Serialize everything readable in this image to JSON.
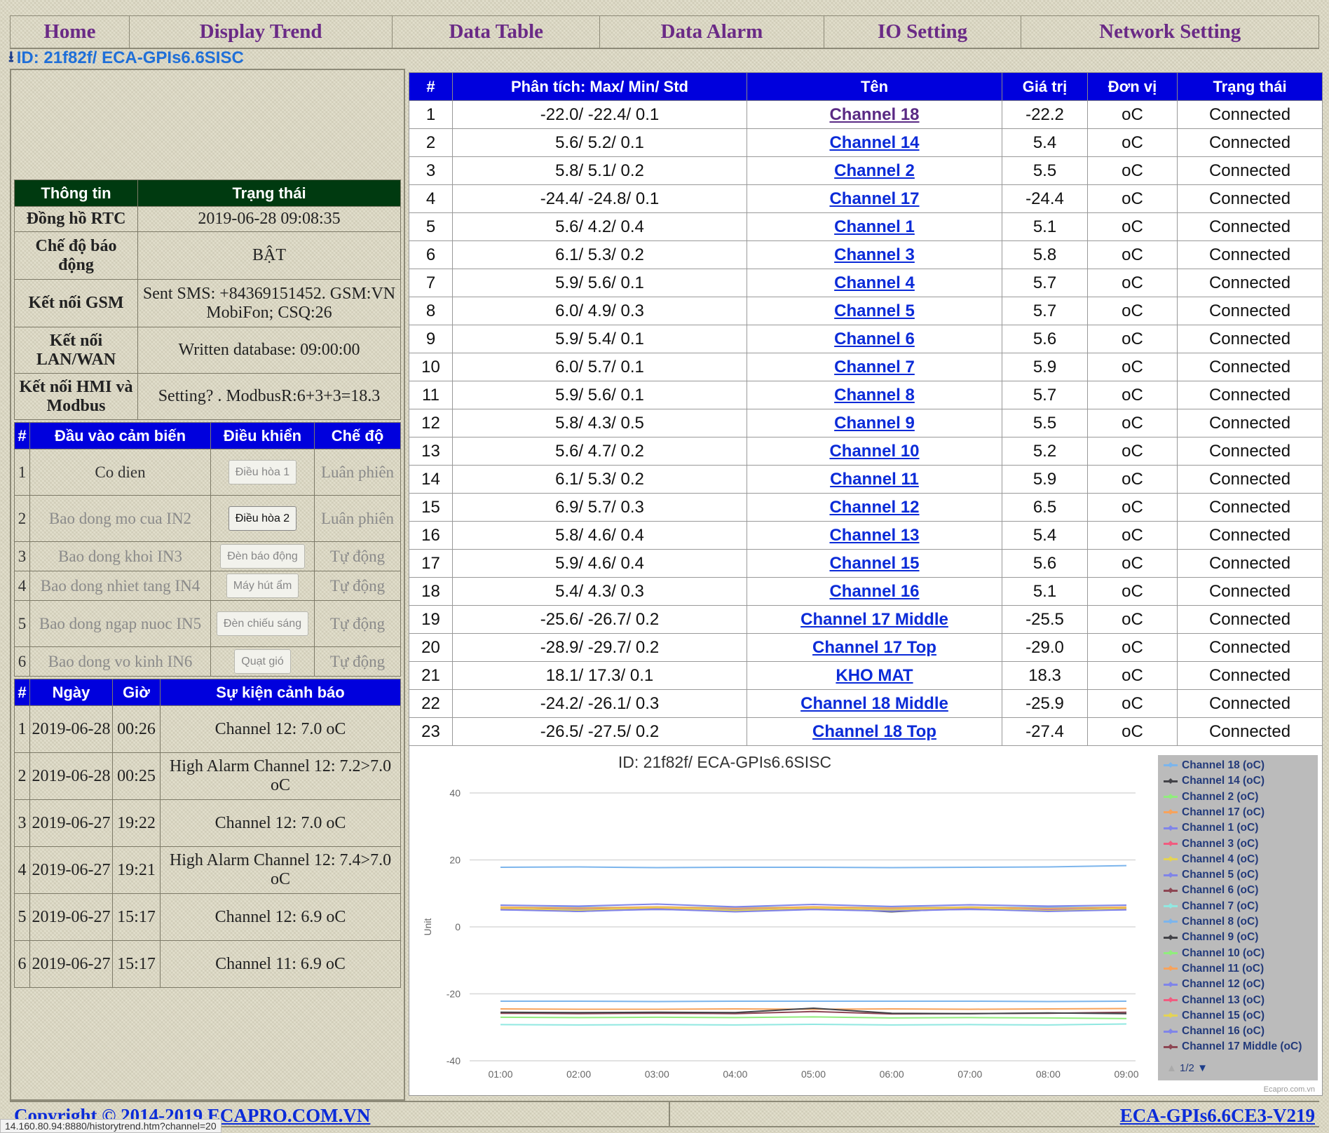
{
  "nav": [
    "Home",
    "Display Trend",
    "Data Table",
    "Data Alarm",
    "IO Setting",
    "Network Setting"
  ],
  "device_id": "ID: 21f82f/ ECA-GPIs6.6SISC",
  "info": {
    "headers": [
      "Thông tin",
      "Trạng thái"
    ],
    "rows": [
      {
        "label": "Đồng hồ RTC",
        "value": "2019-06-28 09:08:35"
      },
      {
        "label": "Chế độ báo động",
        "value": "BẬT"
      },
      {
        "label": "Kết nối GSM",
        "value": "Sent SMS: +84369151452. GSM:VN MobiFon; CSQ:26"
      },
      {
        "label": "Kết nối LAN/WAN",
        "value": "Written database: 09:00:00"
      },
      {
        "label": "Kết nối HMI và Modbus",
        "value": "Setting? . ModbusR:6+3+3=18.3"
      }
    ]
  },
  "sensors": {
    "headers": [
      "#",
      "Đầu vào cảm biến",
      "Điều khiển",
      "Chế độ"
    ],
    "rows": [
      {
        "n": "1",
        "input": "Co dien",
        "control": "Điều hòa 1",
        "mode": "Luân phiên"
      },
      {
        "n": "2",
        "input": "Bao dong mo cua IN2",
        "control": "Điều hòa 2",
        "mode": "Luân phiên"
      },
      {
        "n": "3",
        "input": "Bao dong khoi IN3",
        "control": "Đèn báo động",
        "mode": "Tự động"
      },
      {
        "n": "4",
        "input": "Bao dong nhiet tang IN4",
        "control": "Máy hút ẩm",
        "mode": "Tự động"
      },
      {
        "n": "5",
        "input": "Bao dong ngap nuoc IN5",
        "control": "Đèn chiếu sáng",
        "mode": "Tự động"
      },
      {
        "n": "6",
        "input": "Bao dong vo kinh IN6",
        "control": "Quạt gió",
        "mode": "Tự động"
      }
    ]
  },
  "alarms": {
    "headers": [
      "#",
      "Ngày",
      "Giờ",
      "Sự kiện cảnh báo"
    ],
    "rows": [
      {
        "n": "1",
        "date": "2019-06-28",
        "time": "00:26",
        "event": "Channel 12: 7.0 oC"
      },
      {
        "n": "2",
        "date": "2019-06-28",
        "time": "00:25",
        "event": "High Alarm Channel 12: 7.2>7.0 oC"
      },
      {
        "n": "3",
        "date": "2019-06-27",
        "time": "19:22",
        "event": "Channel 12: 7.0 oC"
      },
      {
        "n": "4",
        "date": "2019-06-27",
        "time": "19:21",
        "event": "High Alarm Channel 12: 7.4>7.0 oC"
      },
      {
        "n": "5",
        "date": "2019-06-27",
        "time": "15:17",
        "event": "Channel 12: 6.9 oC"
      },
      {
        "n": "6",
        "date": "2019-06-27",
        "time": "15:17",
        "event": "Channel 11: 6.9 oC"
      }
    ]
  },
  "data_table": {
    "headers": [
      "#",
      "Phân tích: Max/ Min/ Std",
      "Tên",
      "Giá trị",
      "Đơn vị",
      "Trạng thái"
    ],
    "rows": [
      {
        "n": "1",
        "stats": "-22.0/ -22.4/ 0.1",
        "name": "Channel 18",
        "value": "-22.2",
        "unit": "oC",
        "status": "Connected"
      },
      {
        "n": "2",
        "stats": "5.6/ 5.2/ 0.1",
        "name": "Channel 14",
        "value": "5.4",
        "unit": "oC",
        "status": "Connected"
      },
      {
        "n": "3",
        "stats": "5.8/ 5.1/ 0.2",
        "name": "Channel 2",
        "value": "5.5",
        "unit": "oC",
        "status": "Connected"
      },
      {
        "n": "4",
        "stats": "-24.4/ -24.8/ 0.1",
        "name": "Channel 17",
        "value": "-24.4",
        "unit": "oC",
        "status": "Connected"
      },
      {
        "n": "5",
        "stats": "5.6/ 4.2/ 0.4",
        "name": "Channel 1",
        "value": "5.1",
        "unit": "oC",
        "status": "Connected"
      },
      {
        "n": "6",
        "stats": "6.1/ 5.3/ 0.2",
        "name": "Channel 3",
        "value": "5.8",
        "unit": "oC",
        "status": "Connected"
      },
      {
        "n": "7",
        "stats": "5.9/ 5.6/ 0.1",
        "name": "Channel 4",
        "value": "5.7",
        "unit": "oC",
        "status": "Connected"
      },
      {
        "n": "8",
        "stats": "6.0/ 4.9/ 0.3",
        "name": "Channel 5",
        "value": "5.7",
        "unit": "oC",
        "status": "Connected"
      },
      {
        "n": "9",
        "stats": "5.9/ 5.4/ 0.1",
        "name": "Channel 6",
        "value": "5.6",
        "unit": "oC",
        "status": "Connected"
      },
      {
        "n": "10",
        "stats": "6.0/ 5.7/ 0.1",
        "name": "Channel 7",
        "value": "5.9",
        "unit": "oC",
        "status": "Connected"
      },
      {
        "n": "11",
        "stats": "5.9/ 5.6/ 0.1",
        "name": "Channel 8",
        "value": "5.7",
        "unit": "oC",
        "status": "Connected"
      },
      {
        "n": "12",
        "stats": "5.8/ 4.3/ 0.5",
        "name": "Channel 9",
        "value": "5.5",
        "unit": "oC",
        "status": "Connected"
      },
      {
        "n": "13",
        "stats": "5.6/ 4.7/ 0.2",
        "name": "Channel 10",
        "value": "5.2",
        "unit": "oC",
        "status": "Connected"
      },
      {
        "n": "14",
        "stats": "6.1/ 5.3/ 0.2",
        "name": "Channel 11",
        "value": "5.9",
        "unit": "oC",
        "status": "Connected"
      },
      {
        "n": "15",
        "stats": "6.9/ 5.7/ 0.3",
        "name": "Channel 12",
        "value": "6.5",
        "unit": "oC",
        "status": "Connected"
      },
      {
        "n": "16",
        "stats": "5.8/ 4.6/ 0.4",
        "name": "Channel 13",
        "value": "5.4",
        "unit": "oC",
        "status": "Connected"
      },
      {
        "n": "17",
        "stats": "5.9/ 4.6/ 0.4",
        "name": "Channel 15",
        "value": "5.6",
        "unit": "oC",
        "status": "Connected"
      },
      {
        "n": "18",
        "stats": "5.4/ 4.3/ 0.3",
        "name": "Channel 16",
        "value": "5.1",
        "unit": "oC",
        "status": "Connected"
      },
      {
        "n": "19",
        "stats": "-25.6/ -26.7/ 0.2",
        "name": "Channel 17 Middle",
        "value": "-25.5",
        "unit": "oC",
        "status": "Connected"
      },
      {
        "n": "20",
        "stats": "-28.9/ -29.7/ 0.2",
        "name": "Channel 17 Top",
        "value": "-29.0",
        "unit": "oC",
        "status": "Connected"
      },
      {
        "n": "21",
        "stats": "18.1/ 17.3/ 0.1",
        "name": "KHO MAT",
        "value": "18.3",
        "unit": "oC",
        "status": "Connected"
      },
      {
        "n": "22",
        "stats": "-24.2/ -26.1/ 0.3",
        "name": "Channel 18 Middle",
        "value": "-25.9",
        "unit": "oC",
        "status": "Connected"
      },
      {
        "n": "23",
        "stats": "-26.5/ -27.5/ 0.2",
        "name": "Channel 18 Top",
        "value": "-27.4",
        "unit": "oC",
        "status": "Connected"
      }
    ]
  },
  "chart_data": {
    "type": "line",
    "title": "ID: 21f82f/ ECA-GPIs6.6SISC",
    "ylabel": "Unit",
    "xlabel": "",
    "ylim": [
      -40,
      40
    ],
    "yticks": [
      "40",
      "20",
      "0",
      "-20",
      "-40"
    ],
    "x_ticks": [
      "01:00",
      "02:00",
      "03:00",
      "04:00",
      "05:00",
      "06:00",
      "07:00",
      "08:00",
      "09:00"
    ],
    "grid": "horizontal",
    "legend_position": "right",
    "series": [
      {
        "name": "Channel 18 (oC)",
        "color": "#7cb5ec",
        "values": [
          -22.2,
          -22.2,
          -22.3,
          -22.2,
          -22.2,
          -22.2,
          -22.2,
          -22.3,
          -22.2
        ]
      },
      {
        "name": "Channel 14 (oC)",
        "color": "#434348",
        "values": [
          5.4,
          5.3,
          5.5,
          5.4,
          5.3,
          5.4,
          5.5,
          5.4,
          5.4
        ]
      },
      {
        "name": "Channel 2 (oC)",
        "color": "#90ed7d",
        "values": [
          5.5,
          5.6,
          5.4,
          5.5,
          5.6,
          5.5,
          5.4,
          5.5,
          5.5
        ]
      },
      {
        "name": "Channel 17 (oC)",
        "color": "#f7a35c",
        "values": [
          -24.5,
          -24.6,
          -24.6,
          -24.5,
          -24.6,
          -24.5,
          -24.6,
          -24.5,
          -24.4
        ]
      },
      {
        "name": "Channel 1 (oC)",
        "color": "#8085e9",
        "values": [
          5.1,
          4.8,
          5.2,
          4.9,
          5.3,
          5.0,
          5.2,
          4.9,
          5.1
        ]
      },
      {
        "name": "Channel 3 (oC)",
        "color": "#f15c80",
        "values": [
          5.8,
          5.6,
          5.9,
          5.7,
          5.8,
          5.6,
          5.9,
          5.7,
          5.8
        ]
      },
      {
        "name": "Channel 4 (oC)",
        "color": "#e4d354",
        "values": [
          5.7,
          5.8,
          5.7,
          5.8,
          5.7,
          5.8,
          5.7,
          5.8,
          5.7
        ]
      },
      {
        "name": "Channel 5 (oC)",
        "color": "#8085e8",
        "values": [
          5.7,
          5.2,
          5.9,
          5.3,
          5.8,
          5.4,
          5.9,
          5.3,
          5.7
        ]
      },
      {
        "name": "Channel 6 (oC)",
        "color": "#8d4653",
        "values": [
          5.6,
          5.7,
          5.5,
          5.8,
          5.6,
          5.7,
          5.5,
          5.8,
          5.6
        ]
      },
      {
        "name": "Channel 7 (oC)",
        "color": "#91e8e1",
        "values": [
          5.9,
          5.8,
          5.9,
          5.8,
          5.9,
          5.8,
          5.9,
          5.8,
          5.9
        ]
      },
      {
        "name": "Channel 8 (oC)",
        "color": "#7cb5ec",
        "values": [
          5.7,
          5.8,
          5.6,
          5.7,
          5.8,
          5.6,
          5.7,
          5.8,
          5.7
        ]
      },
      {
        "name": "Channel 9 (oC)",
        "color": "#434348",
        "values": [
          5.5,
          4.6,
          5.6,
          4.8,
          5.7,
          4.5,
          5.6,
          4.7,
          5.5
        ]
      },
      {
        "name": "Channel 10 (oC)",
        "color": "#90ed7d",
        "values": [
          5.2,
          5.0,
          5.4,
          4.9,
          5.3,
          5.1,
          5.4,
          4.9,
          5.2
        ]
      },
      {
        "name": "Channel 11 (oC)",
        "color": "#f7a35c",
        "values": [
          5.9,
          5.6,
          6.0,
          5.5,
          6.0,
          5.6,
          5.9,
          5.5,
          5.9
        ]
      },
      {
        "name": "Channel 12 (oC)",
        "color": "#8085e9",
        "values": [
          6.5,
          6.2,
          6.8,
          6.0,
          6.7,
          6.1,
          6.6,
          6.2,
          6.5
        ]
      },
      {
        "name": "Channel 13 (oC)",
        "color": "#f15c80",
        "values": [
          5.4,
          5.0,
          5.7,
          4.8,
          5.6,
          5.1,
          5.5,
          4.9,
          5.4
        ]
      },
      {
        "name": "Channel 15 (oC)",
        "color": "#e4d354",
        "values": [
          5.6,
          5.0,
          5.8,
          4.9,
          5.7,
          5.1,
          5.8,
          4.8,
          5.6
        ]
      },
      {
        "name": "Channel 16 (oC)",
        "color": "#8085e8",
        "values": [
          5.1,
          4.6,
          5.3,
          4.5,
          5.2,
          4.7,
          5.3,
          4.6,
          5.1
        ]
      },
      {
        "name": "Channel 17 Middle (oC)",
        "color": "#8d4653",
        "values": [
          -25.8,
          -25.9,
          -25.8,
          -25.9,
          -25.3,
          -26.0,
          -25.9,
          -25.8,
          -25.5
        ]
      },
      {
        "name": "Channel 17 Top",
        "color": "#91e8e1",
        "values": [
          -29.2,
          -29.3,
          -29.2,
          -29.3,
          -29.1,
          -29.3,
          -29.2,
          -29.3,
          -29.0
        ]
      },
      {
        "name": "KHO MAT",
        "color": "#7cb5ec",
        "values": [
          17.8,
          17.9,
          17.7,
          17.8,
          17.8,
          17.7,
          17.8,
          17.9,
          18.3
        ]
      },
      {
        "name": "Channel 18 Middle",
        "color": "#434348",
        "values": [
          -25.5,
          -25.6,
          -25.5,
          -25.6,
          -24.3,
          -25.8,
          -25.9,
          -25.7,
          -25.9
        ]
      },
      {
        "name": "Channel 18 Top",
        "color": "#90ed7d",
        "values": [
          -27.0,
          -27.1,
          -27.0,
          -27.1,
          -26.9,
          -27.2,
          -27.1,
          -27.2,
          -27.4
        ]
      }
    ]
  },
  "legend": {
    "items": [
      {
        "label": "Channel 18 (oC)",
        "color": "#7cb5ec"
      },
      {
        "label": "Channel 14 (oC)",
        "color": "#434348"
      },
      {
        "label": "Channel 2 (oC)",
        "color": "#90ed7d"
      },
      {
        "label": "Channel 17 (oC)",
        "color": "#f7a35c"
      },
      {
        "label": "Channel 1 (oC)",
        "color": "#8085e9"
      },
      {
        "label": "Channel 3 (oC)",
        "color": "#f15c80"
      },
      {
        "label": "Channel 4 (oC)",
        "color": "#e4d354"
      },
      {
        "label": "Channel 5 (oC)",
        "color": "#8085e8"
      },
      {
        "label": "Channel 6 (oC)",
        "color": "#8d4653"
      },
      {
        "label": "Channel 7 (oC)",
        "color": "#91e8e1"
      },
      {
        "label": "Channel 8 (oC)",
        "color": "#7cb5ec"
      },
      {
        "label": "Channel 9 (oC)",
        "color": "#434348"
      },
      {
        "label": "Channel 10 (oC)",
        "color": "#90ed7d"
      },
      {
        "label": "Channel 11 (oC)",
        "color": "#f7a35c"
      },
      {
        "label": "Channel 12 (oC)",
        "color": "#8085e9"
      },
      {
        "label": "Channel 13 (oC)",
        "color": "#f15c80"
      },
      {
        "label": "Channel 15 (oC)",
        "color": "#e4d354"
      },
      {
        "label": "Channel 16 (oC)",
        "color": "#8085e8"
      },
      {
        "label": "Channel 17 Middle (oC)",
        "color": "#8d4653"
      }
    ],
    "pager": "1/2"
  },
  "credit": "Ecapro.com.vn",
  "footer": {
    "copyright": "Copyright © 2014-2019 ECAPRO.COM.VN",
    "version": "ECA-GPIs6.6CE3-V219"
  },
  "status_bar": "14.160.80.94:8880/historytrend.htm?channel=20"
}
